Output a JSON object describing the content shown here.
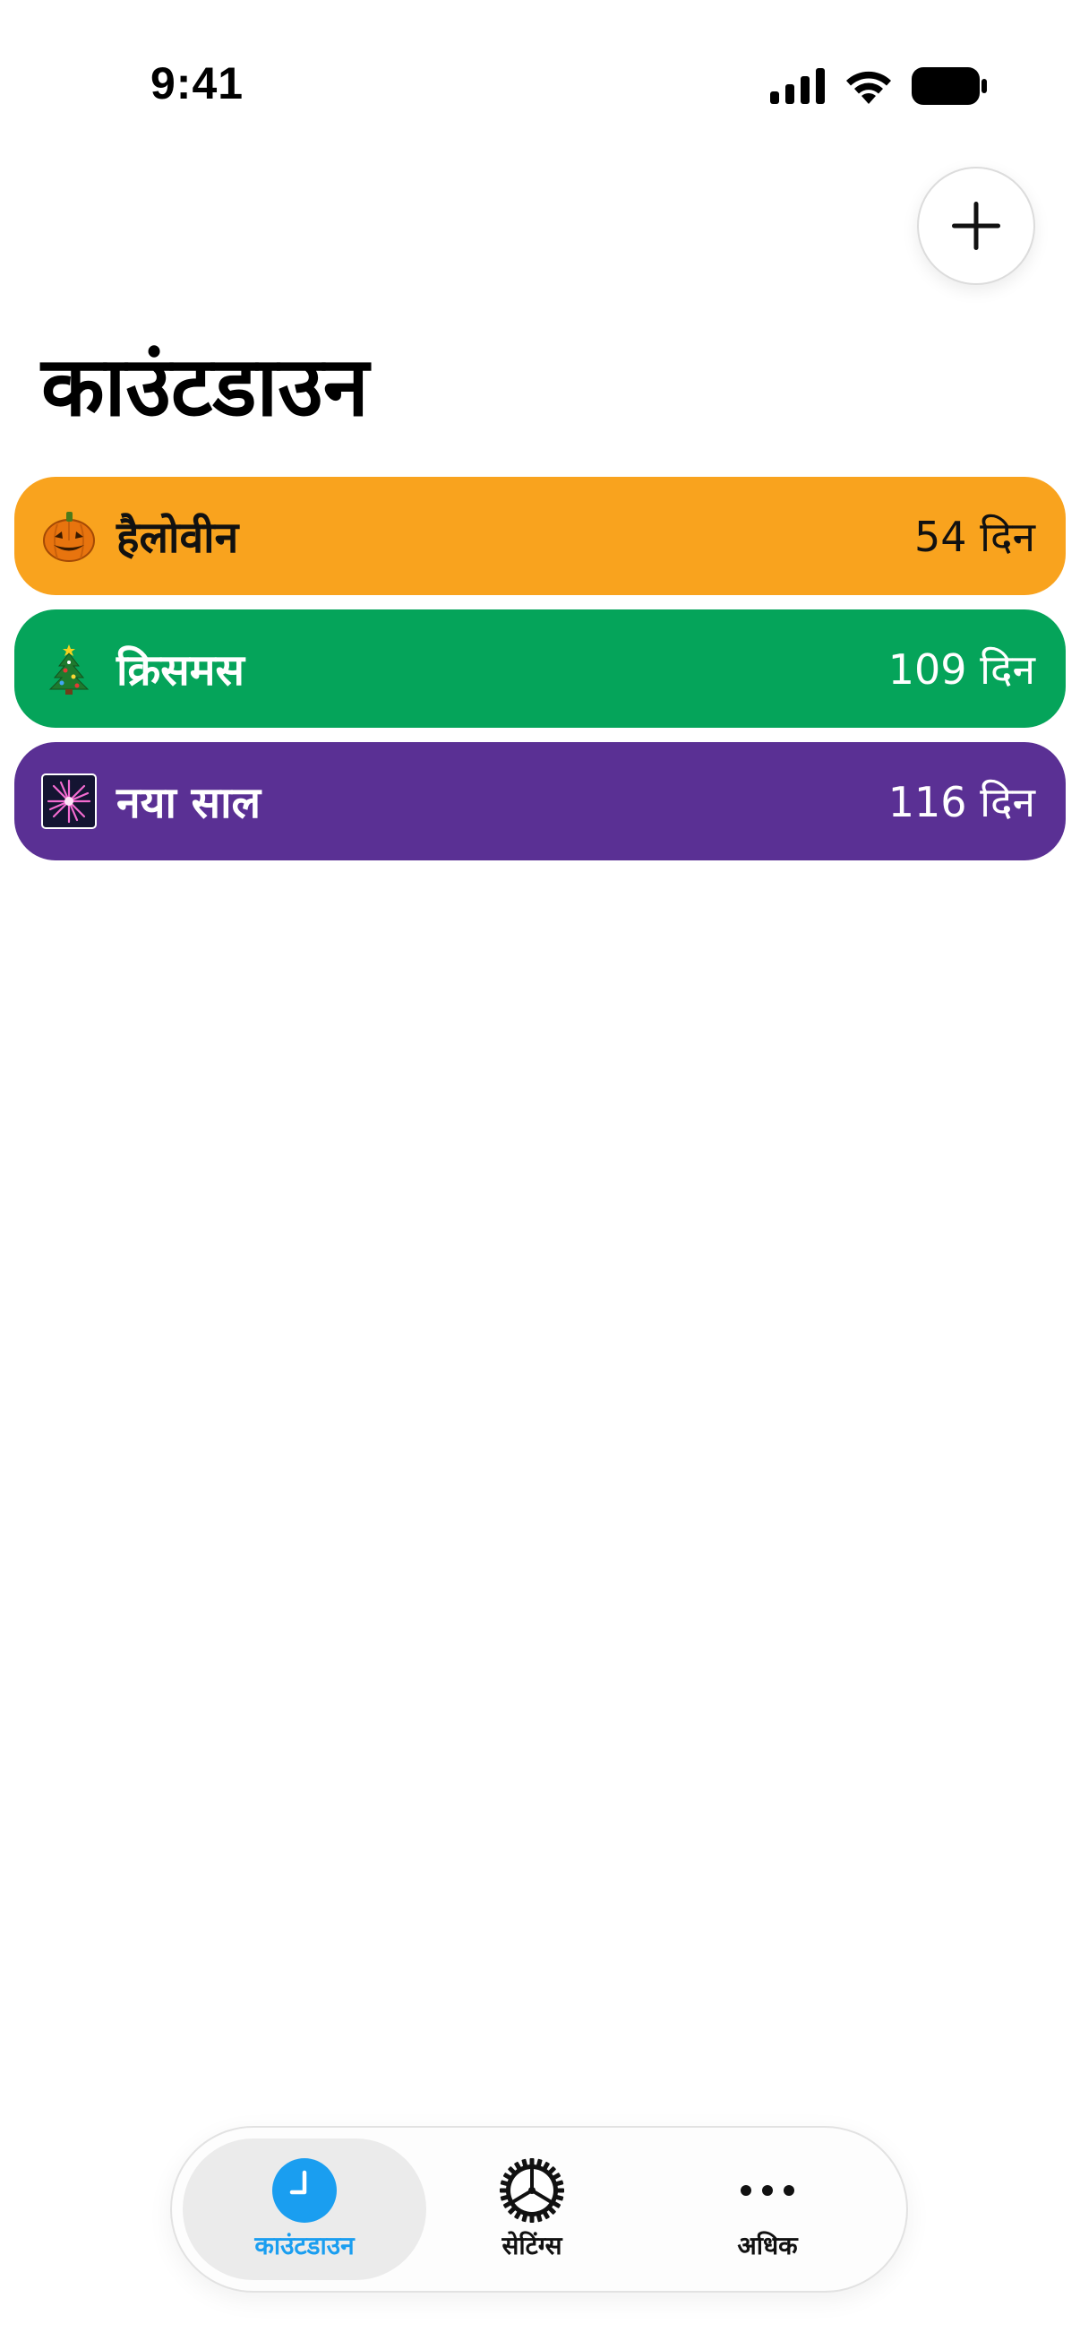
{
  "status_bar": {
    "time": "9:41",
    "icons": [
      "cellular-signal-icon",
      "wifi-icon",
      "battery-icon"
    ]
  },
  "header": {
    "add_icon": "plus-icon",
    "title": "काउंटडाउन"
  },
  "countdowns": [
    {
      "emoji": "jack-o-lantern-icon",
      "name": "हैलोवीन",
      "days": "54 दिन",
      "color": "#F9A31E",
      "text_color": "#111111"
    },
    {
      "emoji": "christmas-tree-icon",
      "name": "क्रिसमस",
      "days": "109 दिन",
      "color": "#05A45A",
      "text_color": "#FFFFFF"
    },
    {
      "emoji": "sparkler-icon",
      "name": "नया साल",
      "days": "116 दिन",
      "color": "#5A3094",
      "text_color": "#FFFFFF"
    }
  ],
  "tab_bar": {
    "tabs": [
      {
        "label": "काउंटडाउन",
        "icon": "clock-icon",
        "active": true
      },
      {
        "label": "सेटिंग्स",
        "icon": "gear-icon",
        "active": false
      },
      {
        "label": "अधिक",
        "icon": "ellipsis-icon",
        "active": false
      }
    ],
    "accent_color": "#1A9EF0"
  }
}
